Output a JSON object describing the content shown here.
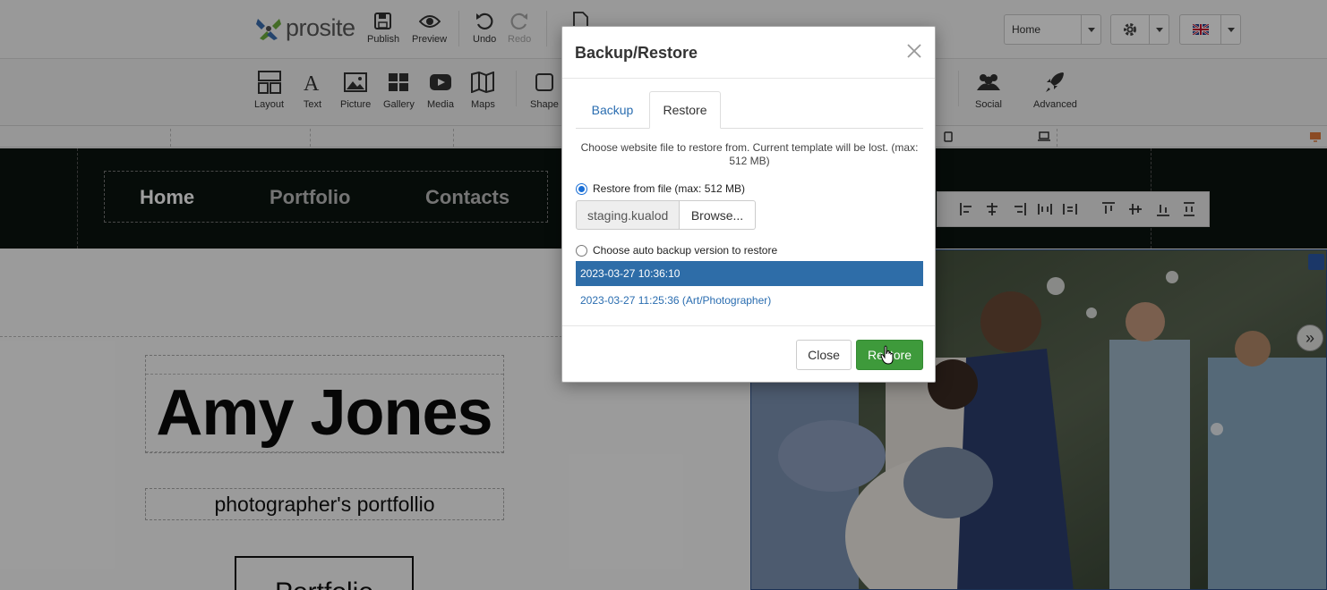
{
  "toolbar": {
    "logo_text": "prosite",
    "publish": "Publish",
    "preview": "Preview",
    "undo": "Undo",
    "redo": "Redo",
    "page_select": "Home"
  },
  "widgets": {
    "layout": "Layout",
    "text": "Text",
    "picture": "Picture",
    "gallery": "Gallery",
    "media": "Media",
    "maps": "Maps",
    "shape": "Shape",
    "social": "Social",
    "advanced": "Advanced"
  },
  "site": {
    "nav": [
      "Home",
      "Portfolio",
      "Contacts"
    ],
    "name": "Amy Jones",
    "subtitle": "photographer's portfollio",
    "button": "Portfolio"
  },
  "modal": {
    "title": "Backup/Restore",
    "tab_backup": "Backup",
    "tab_restore": "Restore",
    "info": "Choose website file to restore from. Current template will be lost. (max: 512 MB)",
    "restore_file_label": "Restore from file (max: 512 MB)",
    "file_name": "staging.kualod",
    "browse": "Browse...",
    "auto_backup_label": "Choose auto backup version to restore",
    "backups": [
      "2023-03-27 10:36:10",
      "2023-03-27 11:25:36 (Art/Photographer)"
    ],
    "close_btn": "Close",
    "restore_btn": "Restore"
  },
  "colors": {
    "accent_blue": "#2e6da8",
    "restore_green": "#3e9a3b",
    "header_dark": "#0b1410"
  }
}
